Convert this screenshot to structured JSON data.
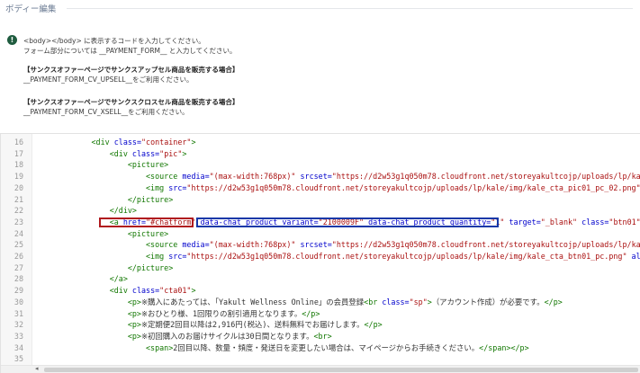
{
  "section": {
    "title": "ボディー編集"
  },
  "info": {
    "icon": "info-icon",
    "lines": [
      "<body></body> に表示するコードを入力してください。",
      "フォーム部分については __PAYMENT_FORM__ と入力してください。",
      "【サンクスオファーページでサンクスアップセル商品を販売する場合】",
      "__PAYMENT_FORM_CV_UPSELL__をご利用ください。",
      "【サンクスオファーページでサンクスクロスセル商品を販売する場合】",
      "__PAYMENT_FORM_CV_XSELL__をご利用ください。"
    ]
  },
  "editor": {
    "line_numbers": [
      "16",
      "17",
      "18",
      "19",
      "20",
      "21",
      "22",
      "23",
      "24",
      "25",
      "26",
      "27",
      "28",
      "29",
      "30",
      "31",
      "32",
      "33",
      "34",
      "35"
    ],
    "lines": [
      [
        {
          "c": "plain",
          "t": "            "
        },
        {
          "c": "tag",
          "t": "<div "
        },
        {
          "c": "attr",
          "t": "class="
        },
        {
          "c": "str",
          "t": "\"container\""
        },
        {
          "c": "tag",
          "t": ">"
        }
      ],
      [
        {
          "c": "plain",
          "t": "                "
        },
        {
          "c": "tag",
          "t": "<div "
        },
        {
          "c": "attr",
          "t": "class="
        },
        {
          "c": "str",
          "t": "\"pic\""
        },
        {
          "c": "tag",
          "t": ">"
        }
      ],
      [
        {
          "c": "plain",
          "t": "                    "
        },
        {
          "c": "tag",
          "t": "<picture>"
        }
      ],
      [
        {
          "c": "plain",
          "t": "                        "
        },
        {
          "c": "tag",
          "t": "<source "
        },
        {
          "c": "attr",
          "t": "media="
        },
        {
          "c": "str",
          "t": "\"(max-width:768px)\""
        },
        {
          "c": "plain",
          "t": " "
        },
        {
          "c": "attr",
          "t": "srcset="
        },
        {
          "c": "str",
          "t": "\"https://d2w53g1q050m78.cloudfront.net/storeyakultcojp/uploads/lp/kale/"
        }
      ],
      [
        {
          "c": "plain",
          "t": "                        "
        },
        {
          "c": "tag",
          "t": "<img "
        },
        {
          "c": "attr",
          "t": "src="
        },
        {
          "c": "str",
          "t": "\"https://d2w53g1q050m78.cloudfront.net/storeyakultcojp/uploads/lp/kale/img/kale_cta_pic01_pc_02.png\""
        },
        {
          "c": "plain",
          "t": " "
        },
        {
          "c": "attr",
          "t": "alt"
        }
      ],
      [
        {
          "c": "plain",
          "t": "                    "
        },
        {
          "c": "tag",
          "t": "</picture>"
        }
      ],
      [
        {
          "c": "plain",
          "t": "                "
        },
        {
          "c": "tag",
          "t": "</div>"
        }
      ],
      [
        {
          "c": "plain",
          "t": "                "
        },
        {
          "c": "tag",
          "t": "<a "
        },
        {
          "c": "attr",
          "t": "href="
        },
        {
          "c": "str",
          "t": "\"#chatform\""
        },
        {
          "c": "plain",
          "t": " "
        },
        {
          "c": "attr",
          "t": "data-chat_product_variant="
        },
        {
          "c": "str",
          "t": "\"2100009F\""
        },
        {
          "c": "plain",
          "t": " "
        },
        {
          "c": "attr",
          "t": "data-chat_product_quantity="
        },
        {
          "c": "str",
          "t": "\"1\""
        },
        {
          "c": "plain",
          "t": " "
        },
        {
          "c": "attr",
          "t": "target="
        },
        {
          "c": "str",
          "t": "\"_blank\""
        },
        {
          "c": "plain",
          "t": " "
        },
        {
          "c": "attr",
          "t": "class="
        },
        {
          "c": "str",
          "t": "\"btn01\""
        },
        {
          "c": "tag",
          "t": ">"
        }
      ],
      [
        {
          "c": "plain",
          "t": "                    "
        },
        {
          "c": "tag",
          "t": "<picture>"
        }
      ],
      [
        {
          "c": "plain",
          "t": "                        "
        },
        {
          "c": "tag",
          "t": "<source "
        },
        {
          "c": "attr",
          "t": "media="
        },
        {
          "c": "str",
          "t": "\"(max-width:768px)\""
        },
        {
          "c": "plain",
          "t": " "
        },
        {
          "c": "attr",
          "t": "srcset="
        },
        {
          "c": "str",
          "t": "\"https://d2w53g1q050m78.cloudfront.net/storeyakultcojp/uploads/lp/kale/"
        }
      ],
      [
        {
          "c": "plain",
          "t": "                        "
        },
        {
          "c": "tag",
          "t": "<img "
        },
        {
          "c": "attr",
          "t": "src="
        },
        {
          "c": "str",
          "t": "\"https://d2w53g1q050m78.cloudfront.net/storeyakultcojp/uploads/lp/kale/img/kale_cta_btn01_pc.png\""
        },
        {
          "c": "plain",
          "t": " "
        },
        {
          "c": "attr",
          "t": "alt="
        },
        {
          "c": "str",
          "t": "\""
        }
      ],
      [
        {
          "c": "plain",
          "t": "                    "
        },
        {
          "c": "tag",
          "t": "</picture>"
        }
      ],
      [
        {
          "c": "plain",
          "t": "                "
        },
        {
          "c": "tag",
          "t": "</a>"
        }
      ],
      [
        {
          "c": "plain",
          "t": "                "
        },
        {
          "c": "tag",
          "t": "<div "
        },
        {
          "c": "attr",
          "t": "class="
        },
        {
          "c": "str",
          "t": "\"cta01\""
        },
        {
          "c": "tag",
          "t": ">"
        }
      ],
      [
        {
          "c": "plain",
          "t": "                    "
        },
        {
          "c": "tag",
          "t": "<p>"
        },
        {
          "c": "plain",
          "t": "※購入にあたっては、「Yakult Wellness Online」の会員登録"
        },
        {
          "c": "tag",
          "t": "<br "
        },
        {
          "c": "attr",
          "t": "class="
        },
        {
          "c": "str",
          "t": "\"sp\""
        },
        {
          "c": "tag",
          "t": ">"
        },
        {
          "c": "plain",
          "t": "（アカウント作成）が必要です。"
        },
        {
          "c": "tag",
          "t": "</p>"
        }
      ],
      [
        {
          "c": "plain",
          "t": "                    "
        },
        {
          "c": "tag",
          "t": "<p>"
        },
        {
          "c": "plain",
          "t": "※おひとり様、1回限りの割引適用となります。"
        },
        {
          "c": "tag",
          "t": "</p>"
        }
      ],
      [
        {
          "c": "plain",
          "t": "                    "
        },
        {
          "c": "tag",
          "t": "<p>"
        },
        {
          "c": "plain",
          "t": "※定期便2回目以降は2,916円(税込)、送料無料でお届けします。"
        },
        {
          "c": "tag",
          "t": "</p>"
        }
      ],
      [
        {
          "c": "plain",
          "t": "                    "
        },
        {
          "c": "tag",
          "t": "<p>"
        },
        {
          "c": "plain",
          "t": "※初回購入のお届けサイクルは30日間となります。"
        },
        {
          "c": "tag",
          "t": "<br>"
        }
      ],
      [
        {
          "c": "plain",
          "t": "                        "
        },
        {
          "c": "tag",
          "t": "<span>"
        },
        {
          "c": "plain",
          "t": "2回目以降、数量・頻度・発送日を変更したい場合は、マイページからお手続きください。"
        },
        {
          "c": "tag",
          "t": "</span></p>"
        }
      ],
      [
        {
          "c": "plain",
          "t": ""
        }
      ]
    ]
  },
  "scrollbar": {
    "left_arrow": "◂"
  }
}
